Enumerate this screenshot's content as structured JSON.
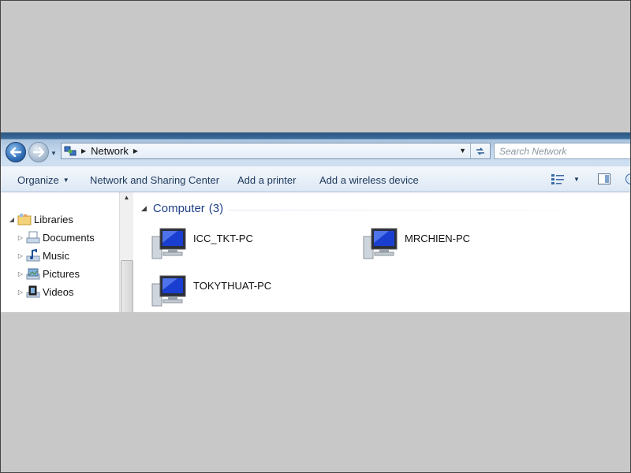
{
  "address_bar": {
    "crumbs": [
      "Network"
    ],
    "search_placeholder": "Search Network"
  },
  "command_bar": {
    "organize": "Organize",
    "network_sharing": "Network and Sharing Center",
    "add_printer": "Add a printer",
    "add_wireless": "Add a wireless device"
  },
  "nav_pane": {
    "items": [
      {
        "label": "Libraries",
        "icon": "libraries-icon",
        "expanded": true
      },
      {
        "label": "Documents",
        "icon": "documents-icon"
      },
      {
        "label": "Music",
        "icon": "music-icon"
      },
      {
        "label": "Pictures",
        "icon": "pictures-icon"
      },
      {
        "label": "Videos",
        "icon": "videos-icon"
      }
    ]
  },
  "content": {
    "group_title": "Computer",
    "group_count": "(3)",
    "computers": [
      {
        "name": "ICC_TKT-PC",
        "icon": "computer-icon"
      },
      {
        "name": "MRCHIEN-PC",
        "icon": "computer-icon"
      },
      {
        "name": "TOKYTHUAT-PC",
        "icon": "computer-icon"
      }
    ]
  },
  "colors": {
    "background": "#c8c8c8",
    "group_header": "#1e3f87",
    "command_text": "#1e395b"
  }
}
